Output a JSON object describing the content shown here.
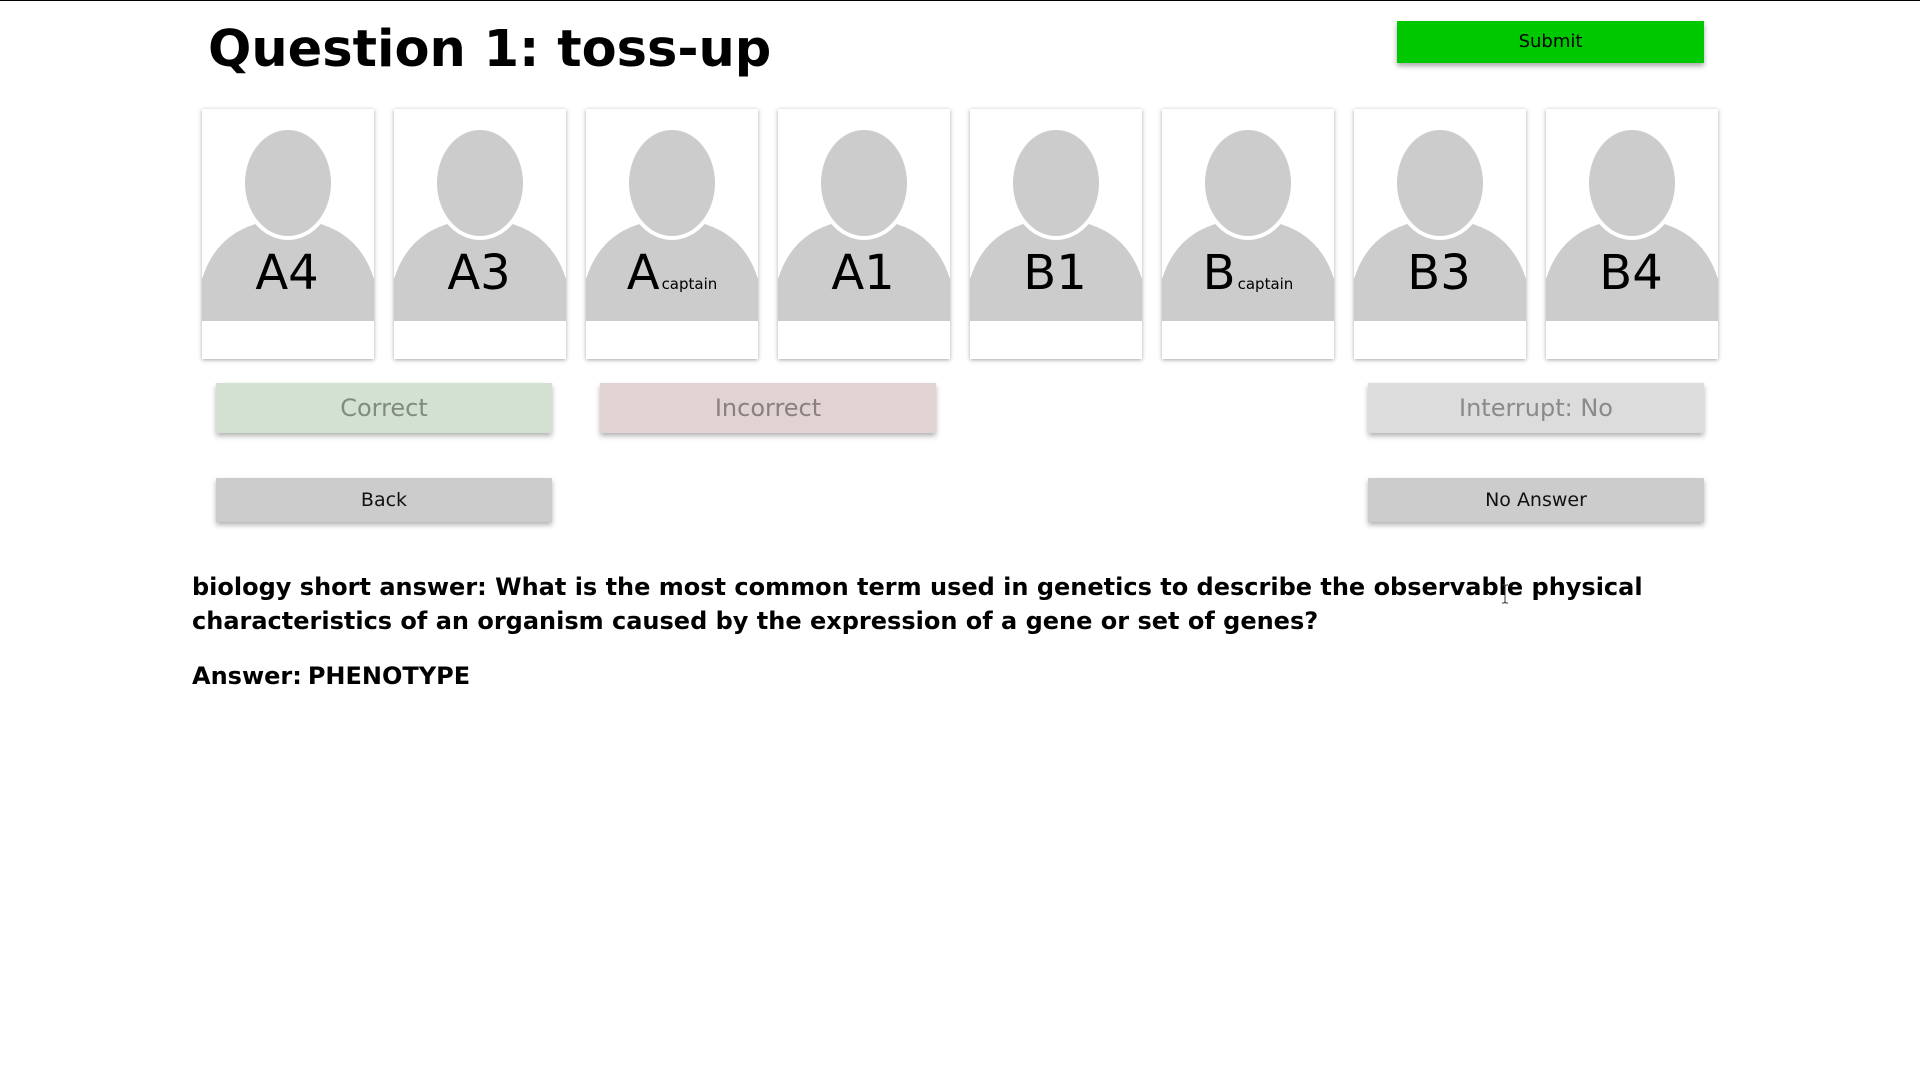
{
  "header": {
    "title": "Question 1: toss-up",
    "submit_label": "Submit"
  },
  "players": [
    {
      "id": "A4",
      "label": "A4",
      "sub": ""
    },
    {
      "id": "A3",
      "label": "A3",
      "sub": ""
    },
    {
      "id": "A-captain",
      "label": "A",
      "sub": "captain"
    },
    {
      "id": "A1",
      "label": "A1",
      "sub": ""
    },
    {
      "id": "B1",
      "label": "B1",
      "sub": ""
    },
    {
      "id": "B-captain",
      "label": "B",
      "sub": "captain"
    },
    {
      "id": "B3",
      "label": "B3",
      "sub": ""
    },
    {
      "id": "B4",
      "label": "B4",
      "sub": ""
    }
  ],
  "actions": {
    "correct_label": "Correct",
    "incorrect_label": "Incorrect",
    "interrupt_label": "Interrupt: No",
    "back_label": "Back",
    "no_answer_label": "No Answer"
  },
  "question": {
    "text": "biology short answer: What is the most common term used in genetics to describe the observable physical characteristics of an organism caused by the expression of a gene or set of genes?",
    "answer_prefix": "Answer:",
    "answer_value": "PHENOTYPE"
  },
  "colors": {
    "submit": "#00c800",
    "correct": "#d3e1d3",
    "incorrect": "#e1d3d3",
    "interrupt": "#dcdcdc",
    "nav": "#cccccc",
    "avatar": "#cccccc"
  },
  "icons": {
    "player_avatar": "person-silhouette-icon",
    "cursor": "text-cursor-icon"
  }
}
